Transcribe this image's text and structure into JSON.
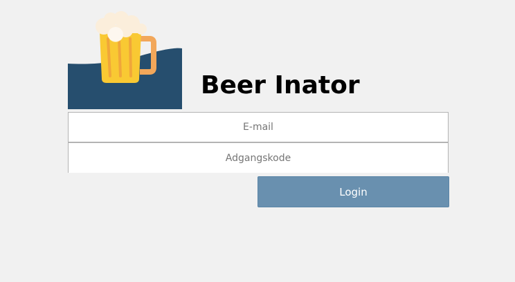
{
  "app": {
    "title": "Beer Inator",
    "logo_icon": "beer-mug-icon"
  },
  "form": {
    "email": {
      "value": "",
      "placeholder": "E-mail"
    },
    "password": {
      "value": "",
      "placeholder": "Adgangskode"
    },
    "login_label": "Login"
  },
  "colors": {
    "background": "#f1f1f1",
    "logo_wave": "#264e6e",
    "mug_body": "#f9c933",
    "mug_handle": "#f2a75a",
    "foam": "#fbeedb",
    "button": "#6990af",
    "button_text": "#ffffff"
  }
}
